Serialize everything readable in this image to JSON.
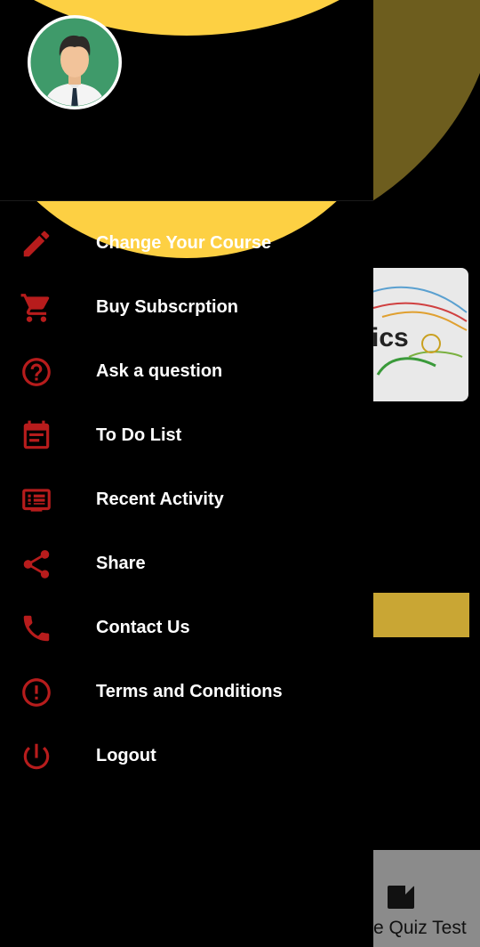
{
  "background_app": {
    "card_text": "ics",
    "bottom_nav_label": "e Quiz Test"
  },
  "drawer": {
    "avatar_icon": "user-avatar-icon",
    "accent_color": "#b71c1c",
    "header_color": "#fdd043",
    "menu": [
      {
        "label": "Change Your Course",
        "icon": "pencil-icon"
      },
      {
        "label": "Buy Subscrption",
        "icon": "cart-icon"
      },
      {
        "label": "Ask a question",
        "icon": "help-circle-icon"
      },
      {
        "label": "To Do List",
        "icon": "calendar-icon"
      },
      {
        "label": "Recent Activity",
        "icon": "list-icon"
      },
      {
        "label": "Share",
        "icon": "share-icon"
      },
      {
        "label": "Contact Us",
        "icon": "phone-icon"
      },
      {
        "label": "Terms and Conditions",
        "icon": "alert-circle-icon"
      },
      {
        "label": "Logout",
        "icon": "power-icon"
      }
    ]
  }
}
